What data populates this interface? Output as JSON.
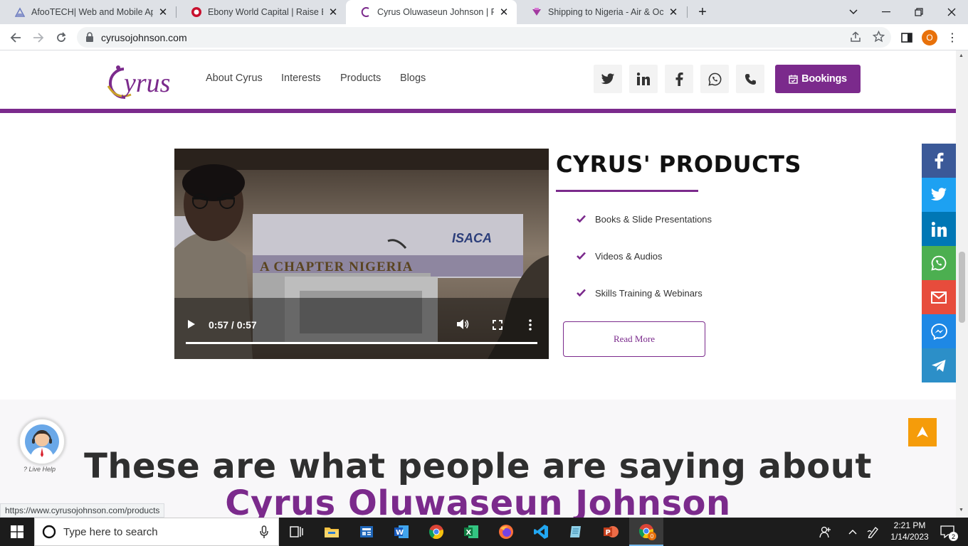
{
  "browser": {
    "tabs": [
      {
        "title": "AfooTECH| Web and Mobile App",
        "active": false
      },
      {
        "title": "Ebony World Capital | Raise Busin",
        "active": false
      },
      {
        "title": "Cyrus Oluwaseun Johnson | Perso",
        "active": true
      },
      {
        "title": "Shipping to Nigeria - Air & Ocea",
        "active": false
      }
    ],
    "url": "cyrusojohnson.com",
    "profile_initial": "O",
    "status_url": "https://www.cyrusojohnson.com/products"
  },
  "header": {
    "logo_text": "yrus",
    "nav": [
      "About Cyrus",
      "Interests",
      "Products",
      "Blogs"
    ],
    "bookings_label": "Bookings"
  },
  "video": {
    "time": "0:57 / 0:57",
    "banner_text": "A CHAPTER NIGERIA",
    "logo_text": "ISACA",
    "progress": 1.0
  },
  "products": {
    "title": "CYRUS' PRODUCTS",
    "items": [
      "Books & Slide Presentations",
      "Videos & Audios",
      "Skills Training & Webinars"
    ],
    "read_more": "Read More"
  },
  "testimonials": {
    "heading": "These are what people are saying about",
    "name": "Cyrus Oluwaseun Johnson"
  },
  "live_help": "? Live Help",
  "colors": {
    "brand": "#7b2a8c",
    "scroll_top": "#f59c0a"
  },
  "taskbar": {
    "search_placeholder": "Type here to search",
    "time": "2:21 PM",
    "date": "1/14/2023",
    "notifications": "2",
    "chrome_badge": "0"
  }
}
